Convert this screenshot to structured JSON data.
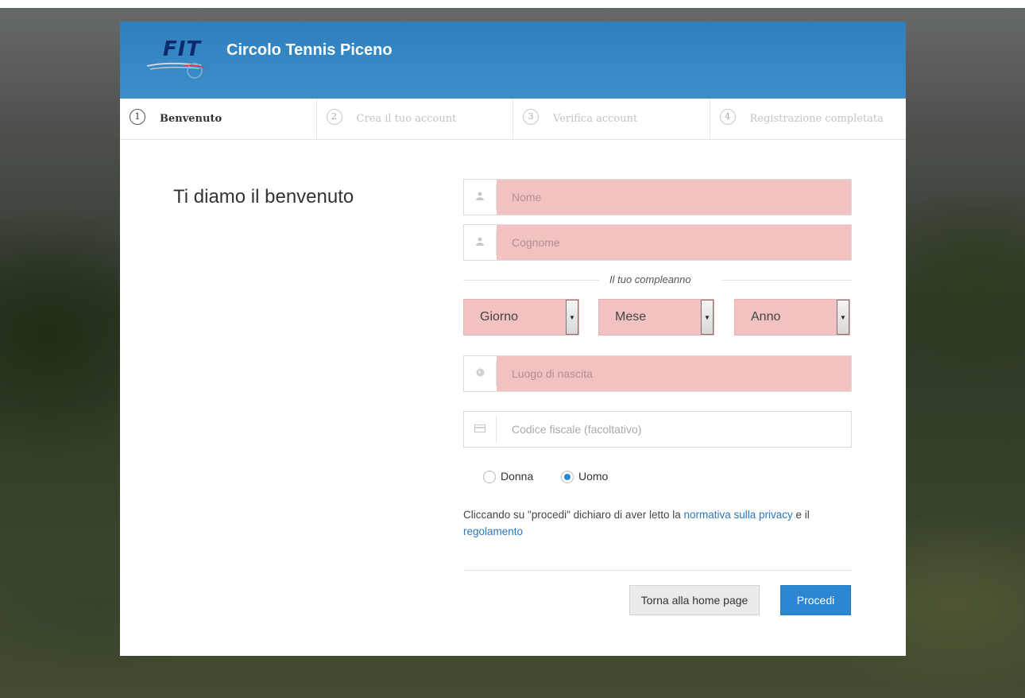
{
  "header": {
    "logo_text": "FIT",
    "club_name": "Circolo Tennis Piceno"
  },
  "steps": [
    {
      "num": "1",
      "label": "Benvenuto",
      "active": true
    },
    {
      "num": "2",
      "label": "Crea il tuo account",
      "active": false
    },
    {
      "num": "3",
      "label": "Verifica account",
      "active": false
    },
    {
      "num": "4",
      "label": "Registrazione completata",
      "active": false
    }
  ],
  "welcome_title": "Ti diamo il benvenuto",
  "form": {
    "first_name_placeholder": "Nome",
    "last_name_placeholder": "Cognome",
    "birthday_label": "Il tuo compleanno",
    "day_value": "Giorno",
    "month_value": "Mese",
    "year_value": "Anno",
    "birthplace_placeholder": "Luogo di nascita",
    "tax_code_placeholder": "Codice fiscale (facoltativo)",
    "gender_female": "Donna",
    "gender_male": "Uomo",
    "selected_gender": "Uomo"
  },
  "privacy": {
    "text_before": "Cliccando su \"procedi\" dichiaro di aver letto la ",
    "privacy_link": "normativa sulla privacy",
    "text_between": " e il ",
    "rules_link": "regolamento"
  },
  "buttons": {
    "home": "Torna alla home page",
    "proceed": "Procedi"
  },
  "colors": {
    "header_blue": "#3c8fcb",
    "invalid_field": "#f2c1c1",
    "primary_button": "#2b87d1",
    "link": "#2e76b8"
  },
  "icons": {
    "name_field": "user-icon",
    "surname_field": "user-icon",
    "birthplace_field": "globe-icon",
    "tax_code_field": "card-icon"
  }
}
